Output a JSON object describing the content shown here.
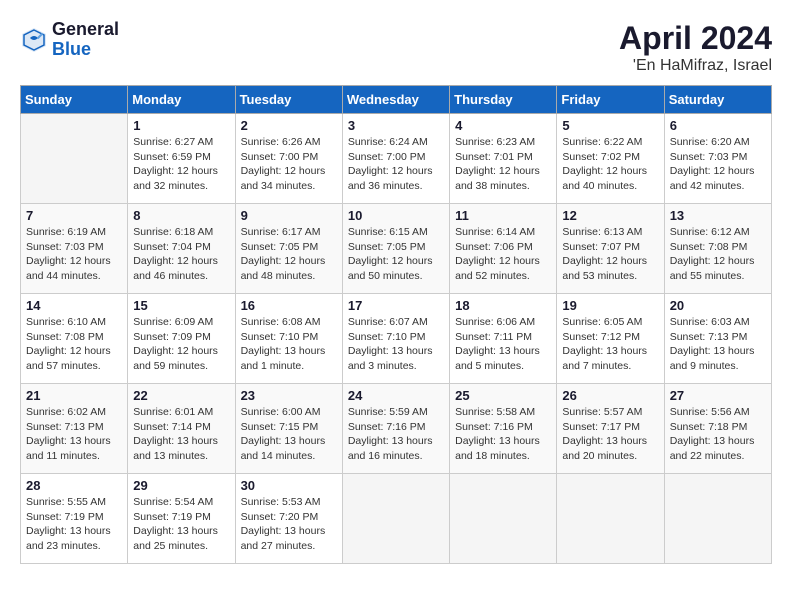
{
  "header": {
    "logo_general": "General",
    "logo_blue": "Blue",
    "month_year": "April 2024",
    "location": "'En HaMifraz, Israel"
  },
  "weekdays": [
    "Sunday",
    "Monday",
    "Tuesday",
    "Wednesday",
    "Thursday",
    "Friday",
    "Saturday"
  ],
  "weeks": [
    [
      {
        "day": "",
        "info": ""
      },
      {
        "day": "1",
        "info": "Sunrise: 6:27 AM\nSunset: 6:59 PM\nDaylight: 12 hours\nand 32 minutes."
      },
      {
        "day": "2",
        "info": "Sunrise: 6:26 AM\nSunset: 7:00 PM\nDaylight: 12 hours\nand 34 minutes."
      },
      {
        "day": "3",
        "info": "Sunrise: 6:24 AM\nSunset: 7:00 PM\nDaylight: 12 hours\nand 36 minutes."
      },
      {
        "day": "4",
        "info": "Sunrise: 6:23 AM\nSunset: 7:01 PM\nDaylight: 12 hours\nand 38 minutes."
      },
      {
        "day": "5",
        "info": "Sunrise: 6:22 AM\nSunset: 7:02 PM\nDaylight: 12 hours\nand 40 minutes."
      },
      {
        "day": "6",
        "info": "Sunrise: 6:20 AM\nSunset: 7:03 PM\nDaylight: 12 hours\nand 42 minutes."
      }
    ],
    [
      {
        "day": "7",
        "info": "Sunrise: 6:19 AM\nSunset: 7:03 PM\nDaylight: 12 hours\nand 44 minutes."
      },
      {
        "day": "8",
        "info": "Sunrise: 6:18 AM\nSunset: 7:04 PM\nDaylight: 12 hours\nand 46 minutes."
      },
      {
        "day": "9",
        "info": "Sunrise: 6:17 AM\nSunset: 7:05 PM\nDaylight: 12 hours\nand 48 minutes."
      },
      {
        "day": "10",
        "info": "Sunrise: 6:15 AM\nSunset: 7:05 PM\nDaylight: 12 hours\nand 50 minutes."
      },
      {
        "day": "11",
        "info": "Sunrise: 6:14 AM\nSunset: 7:06 PM\nDaylight: 12 hours\nand 52 minutes."
      },
      {
        "day": "12",
        "info": "Sunrise: 6:13 AM\nSunset: 7:07 PM\nDaylight: 12 hours\nand 53 minutes."
      },
      {
        "day": "13",
        "info": "Sunrise: 6:12 AM\nSunset: 7:08 PM\nDaylight: 12 hours\nand 55 minutes."
      }
    ],
    [
      {
        "day": "14",
        "info": "Sunrise: 6:10 AM\nSunset: 7:08 PM\nDaylight: 12 hours\nand 57 minutes."
      },
      {
        "day": "15",
        "info": "Sunrise: 6:09 AM\nSunset: 7:09 PM\nDaylight: 12 hours\nand 59 minutes."
      },
      {
        "day": "16",
        "info": "Sunrise: 6:08 AM\nSunset: 7:10 PM\nDaylight: 13 hours\nand 1 minute."
      },
      {
        "day": "17",
        "info": "Sunrise: 6:07 AM\nSunset: 7:10 PM\nDaylight: 13 hours\nand 3 minutes."
      },
      {
        "day": "18",
        "info": "Sunrise: 6:06 AM\nSunset: 7:11 PM\nDaylight: 13 hours\nand 5 minutes."
      },
      {
        "day": "19",
        "info": "Sunrise: 6:05 AM\nSunset: 7:12 PM\nDaylight: 13 hours\nand 7 minutes."
      },
      {
        "day": "20",
        "info": "Sunrise: 6:03 AM\nSunset: 7:13 PM\nDaylight: 13 hours\nand 9 minutes."
      }
    ],
    [
      {
        "day": "21",
        "info": "Sunrise: 6:02 AM\nSunset: 7:13 PM\nDaylight: 13 hours\nand 11 minutes."
      },
      {
        "day": "22",
        "info": "Sunrise: 6:01 AM\nSunset: 7:14 PM\nDaylight: 13 hours\nand 13 minutes."
      },
      {
        "day": "23",
        "info": "Sunrise: 6:00 AM\nSunset: 7:15 PM\nDaylight: 13 hours\nand 14 minutes."
      },
      {
        "day": "24",
        "info": "Sunrise: 5:59 AM\nSunset: 7:16 PM\nDaylight: 13 hours\nand 16 minutes."
      },
      {
        "day": "25",
        "info": "Sunrise: 5:58 AM\nSunset: 7:16 PM\nDaylight: 13 hours\nand 18 minutes."
      },
      {
        "day": "26",
        "info": "Sunrise: 5:57 AM\nSunset: 7:17 PM\nDaylight: 13 hours\nand 20 minutes."
      },
      {
        "day": "27",
        "info": "Sunrise: 5:56 AM\nSunset: 7:18 PM\nDaylight: 13 hours\nand 22 minutes."
      }
    ],
    [
      {
        "day": "28",
        "info": "Sunrise: 5:55 AM\nSunset: 7:19 PM\nDaylight: 13 hours\nand 23 minutes."
      },
      {
        "day": "29",
        "info": "Sunrise: 5:54 AM\nSunset: 7:19 PM\nDaylight: 13 hours\nand 25 minutes."
      },
      {
        "day": "30",
        "info": "Sunrise: 5:53 AM\nSunset: 7:20 PM\nDaylight: 13 hours\nand 27 minutes."
      },
      {
        "day": "",
        "info": ""
      },
      {
        "day": "",
        "info": ""
      },
      {
        "day": "",
        "info": ""
      },
      {
        "day": "",
        "info": ""
      }
    ]
  ]
}
